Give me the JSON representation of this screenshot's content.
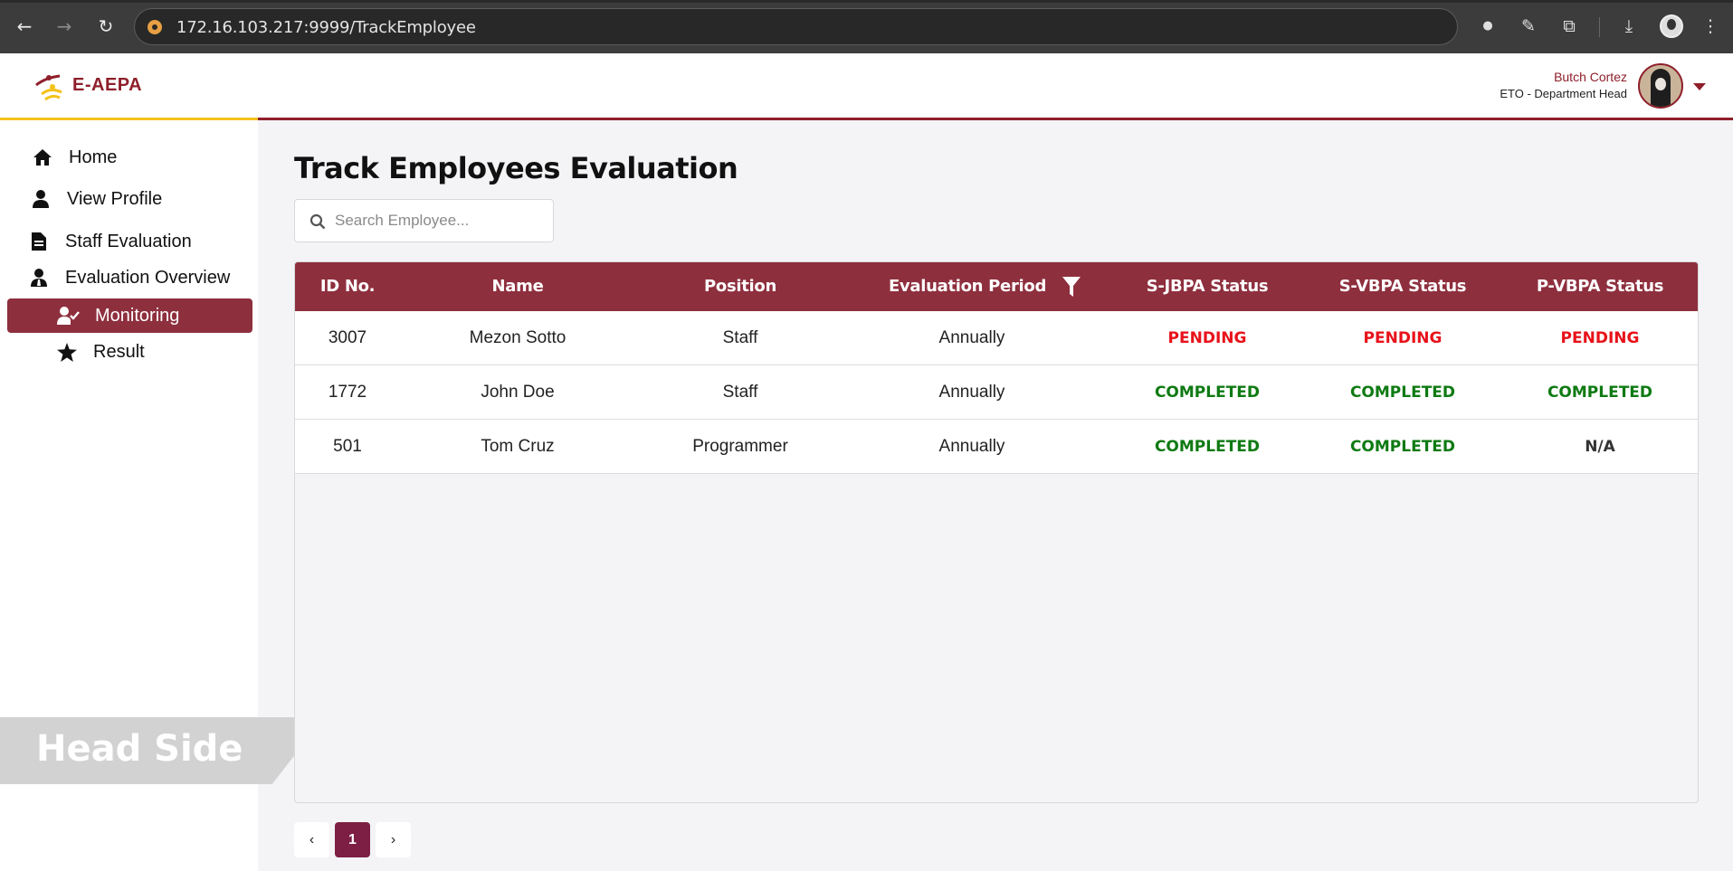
{
  "browser": {
    "url": "172.16.103.217:9999/TrackEmployee"
  },
  "header": {
    "logo_text": "E-AEPA",
    "user_name": "Butch Cortez",
    "user_role": "ETO - Department Head"
  },
  "sidebar": {
    "items": [
      {
        "label": "Home",
        "icon": "home-icon"
      },
      {
        "label": "View Profile",
        "icon": "user-icon"
      },
      {
        "label": "Staff Evaluation",
        "icon": "document-icon"
      },
      {
        "label": "Evaluation Overview",
        "icon": "user-tie-icon"
      },
      {
        "label": "Monitoring",
        "icon": "user-check-icon",
        "active": true
      },
      {
        "label": "Result",
        "icon": "star-icon"
      }
    ]
  },
  "watermark": "Head Side",
  "main": {
    "title": "Track Employees Evaluation",
    "search_placeholder": "Search Employee...",
    "columns": [
      "ID No.",
      "Name",
      "Position",
      "Evaluation Period",
      "S-JBPA Status",
      "S-VBPA Status",
      "P-VBPA Status"
    ],
    "rows": [
      {
        "id": "3007",
        "name": "Mezon Sotto",
        "position": "Staff",
        "period": "Annually",
        "sjbpa": "PENDING",
        "svbpa": "PENDING",
        "pvbpa": "PENDING"
      },
      {
        "id": "1772",
        "name": "John Doe",
        "position": "Staff",
        "period": "Annually",
        "sjbpa": "COMPLETED",
        "svbpa": "COMPLETED",
        "pvbpa": "COMPLETED"
      },
      {
        "id": "501",
        "name": "Tom Cruz",
        "position": "Programmer",
        "period": "Annually",
        "sjbpa": "COMPLETED",
        "svbpa": "COMPLETED",
        "pvbpa": "N/A"
      }
    ]
  },
  "pagination": {
    "prev": "‹",
    "current": "1",
    "next": "›"
  },
  "colors": {
    "brand": "#8e1f2a",
    "table_header": "#8e2f3e",
    "pending": "#e8121a",
    "completed": "#0e7a12"
  }
}
